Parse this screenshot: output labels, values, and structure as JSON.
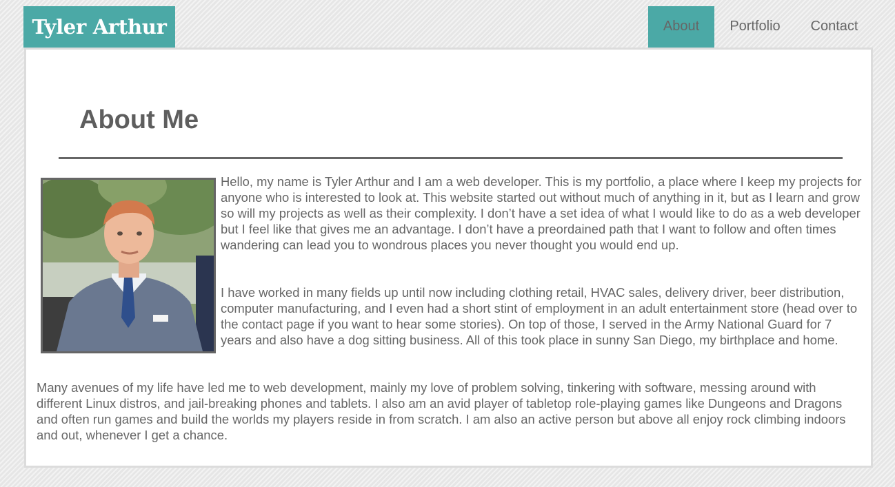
{
  "header": {
    "brand": "Tyler Arthur",
    "nav": [
      {
        "label": "About",
        "active": true
      },
      {
        "label": "Portfolio",
        "active": false
      },
      {
        "label": "Contact",
        "active": false
      }
    ]
  },
  "colors": {
    "accent": "#4ba9a6",
    "text": "#666666",
    "panel": "#ffffff",
    "background": "#ececec"
  },
  "about": {
    "title": "About Me",
    "photo": "portrait-photo",
    "paragraphs": [
      "Hello, my name is Tyler Arthur and I am a web developer. This is my portfolio, a place where I keep my projects for anyone who is interested to look at. This website started out without much of anything in it, but as I learn and grow so will my projects as well as their complexity. I don’t have a set idea of what I would like to do as a web developer but I feel like that gives me an advantage. I don’t have a preordained path that I want to follow and often times wandering can lead you to wondrous places you never thought you would end up.",
      "I have worked in many fields up until now including clothing retail, HVAC sales, delivery driver, beer distribution, computer manufacturing, and I even had a short stint of employment in an adult entertainment store (head over to the contact page if you want to hear some stories). On top of those, I served in the Army National Guard for 7 years and also have a dog sitting business. All of this took place in sunny San Diego, my birthplace and home.",
      "Many avenues of my life have led me to web development, mainly my love of problem solving, tinkering with software, messing around with different Linux distros, and jail-breaking phones and tablets. I also am an avid player of tabletop role-playing games like Dungeons and Dragons and often run games and build the worlds my players reside in from scratch. I am also an active person but above all enjoy rock climbing indoors and out, whenever I get a chance."
    ]
  }
}
